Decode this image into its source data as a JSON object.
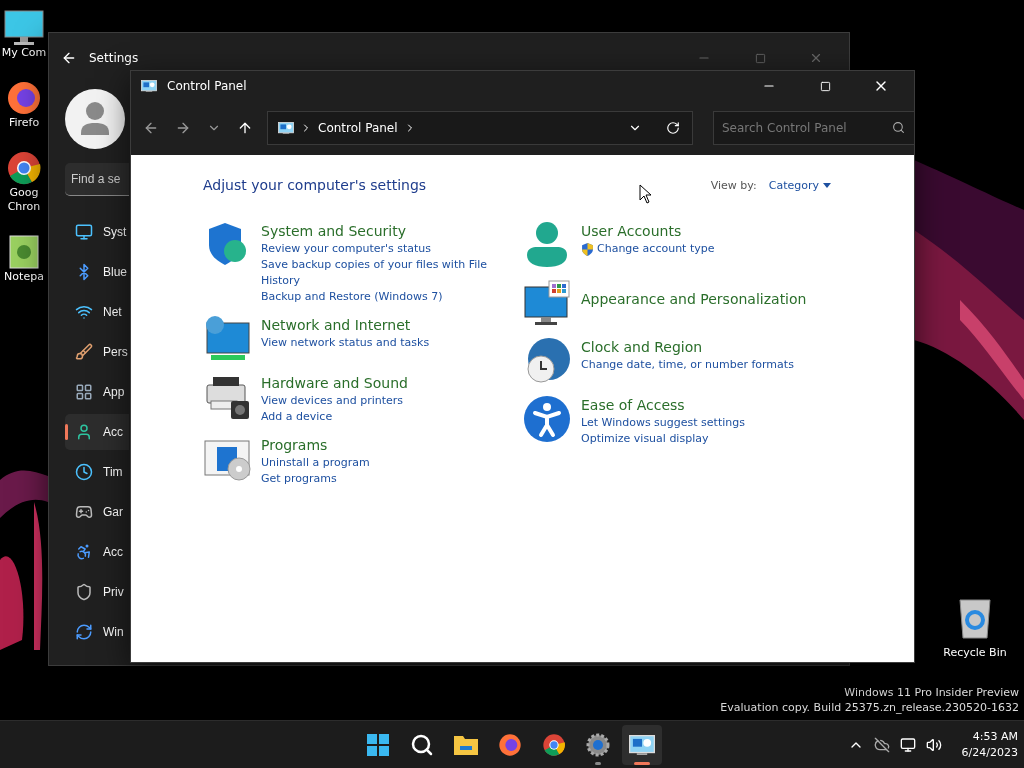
{
  "desktop_icons": [
    {
      "label": "My Com"
    },
    {
      "label": "Firefo"
    },
    {
      "label": "Goog Chron"
    },
    {
      "label": "Notepa"
    }
  ],
  "recycle_bin": {
    "label": "Recycle Bin"
  },
  "settings_window": {
    "title": "Settings",
    "search": {
      "placeholder": "Find a se"
    },
    "nav": [
      {
        "label": "Syst",
        "selected": false
      },
      {
        "label": "Blue",
        "selected": false
      },
      {
        "label": "Net",
        "selected": false
      },
      {
        "label": "Pers",
        "selected": false
      },
      {
        "label": "App",
        "selected": false
      },
      {
        "label": "Acc",
        "selected": true
      },
      {
        "label": "Tim",
        "selected": false
      },
      {
        "label": "Gar",
        "selected": false
      },
      {
        "label": "Acc",
        "selected": false
      },
      {
        "label": "Priv",
        "selected": false
      },
      {
        "label": "Win",
        "selected": false
      }
    ]
  },
  "control_panel": {
    "title": "Control Panel",
    "address": {
      "path": [
        "Control Panel"
      ]
    },
    "search": {
      "placeholder": "Search Control Panel"
    },
    "heading": "Adjust your computer's settings",
    "view_by": {
      "label": "View by:",
      "value": "Category"
    },
    "columns": [
      [
        {
          "title": "System and Security",
          "links": [
            {
              "text": "Review your computer's status",
              "admin": false
            },
            {
              "text": "Save backup copies of your files with File History",
              "admin": false
            },
            {
              "text": "Backup and Restore (Windows 7)",
              "admin": false
            }
          ]
        },
        {
          "title": "Network and Internet",
          "links": [
            {
              "text": "View network status and tasks",
              "admin": false
            }
          ]
        },
        {
          "title": "Hardware and Sound",
          "links": [
            {
              "text": "View devices and printers",
              "admin": false
            },
            {
              "text": "Add a device",
              "admin": false
            }
          ]
        },
        {
          "title": "Programs",
          "links": [
            {
              "text": "Uninstall a program",
              "admin": false
            },
            {
              "text": "Get programs",
              "admin": false
            }
          ]
        }
      ],
      [
        {
          "title": "User Accounts",
          "links": [
            {
              "text": "Change account type",
              "admin": true
            }
          ]
        },
        {
          "title": "Appearance and Personalization"
        },
        {
          "title": "Clock and Region",
          "links": [
            {
              "text": "Change date, time, or number formats",
              "admin": false
            }
          ]
        },
        {
          "title": "Ease of Access",
          "links": [
            {
              "text": "Let Windows suggest settings",
              "admin": false
            },
            {
              "text": "Optimize visual display",
              "admin": false
            }
          ]
        }
      ]
    ]
  },
  "build_info": [
    "Windows 11 Pro Insider Preview",
    "Evaluation copy. Build 25375.zn_release.230520-1632"
  ],
  "taskbar": {
    "apps": [
      {
        "selected": false,
        "running": false
      },
      {
        "selected": false,
        "running": false
      },
      {
        "selected": false,
        "running": false
      },
      {
        "selected": false,
        "running": false
      },
      {
        "selected": false,
        "running": false
      },
      {
        "selected": false,
        "running": true
      },
      {
        "selected": true,
        "running": true
      }
    ],
    "time": "4:53 AM",
    "date": "6/24/2023"
  }
}
